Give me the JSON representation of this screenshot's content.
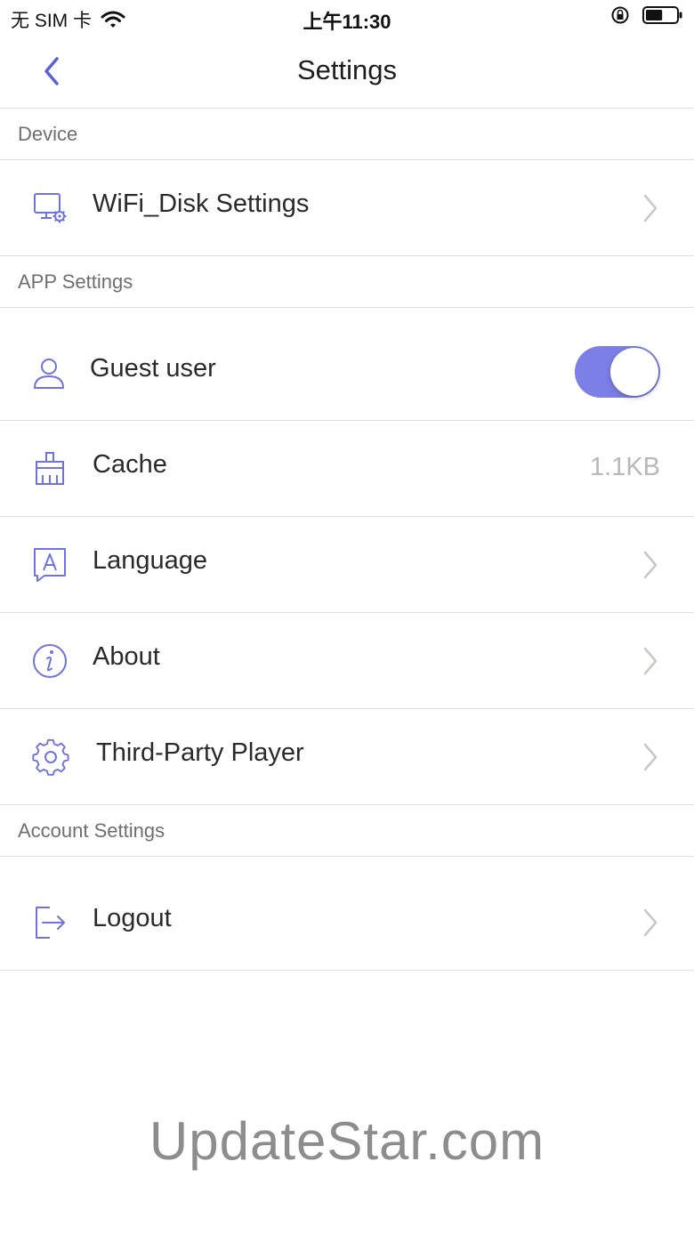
{
  "status_bar": {
    "carrier": "无 SIM 卡",
    "time": "上午11:30",
    "battery_level": 0.55
  },
  "nav": {
    "title": "Settings",
    "back_icon": "chevron-left-icon"
  },
  "sections": {
    "device": {
      "header": "Device",
      "items": [
        {
          "label": "WiFi_Disk Settings",
          "icon": "disk-settings-icon"
        }
      ]
    },
    "app": {
      "header": "APP Settings",
      "items": [
        {
          "label": "Guest user",
          "icon": "user-icon",
          "toggle_on": true
        },
        {
          "label": "Cache",
          "icon": "broom-icon",
          "value": "1.1KB"
        },
        {
          "label": "Language",
          "icon": "language-icon"
        },
        {
          "label": "About",
          "icon": "info-icon"
        },
        {
          "label": "Third-Party Player",
          "icon": "gear-icon"
        }
      ]
    },
    "account": {
      "header": "Account Settings",
      "items": [
        {
          "label": "Logout",
          "icon": "logout-icon"
        }
      ]
    }
  },
  "watermark": "UpdateStar.com",
  "colors": {
    "accent": "#6e73de",
    "toggle_on": "#7b7fe6",
    "divider": "#e1e1e1",
    "muted_value": "#b8b8b8"
  }
}
